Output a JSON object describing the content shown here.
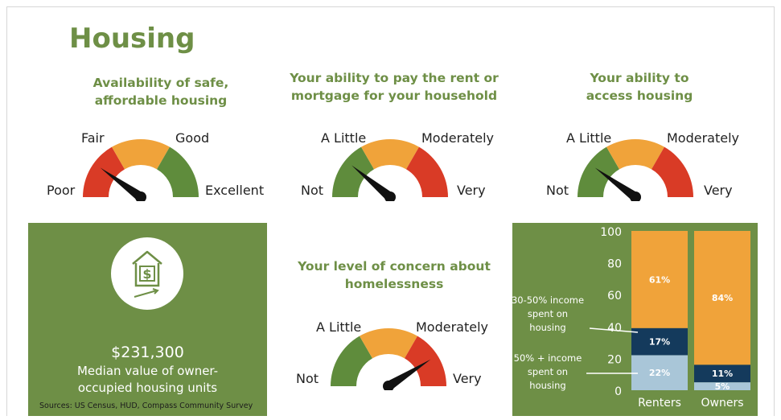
{
  "page": {
    "title": "Housing"
  },
  "gauges": [
    {
      "title_line1": "Availability of safe,",
      "title_line2": "affordable housing",
      "labels": {
        "far_left": "Poor",
        "upper_left": "Fair",
        "upper_right": "Good",
        "far_right": "Excellent"
      },
      "segment_colors": [
        "#d93b26",
        "#f0a33a",
        "#5f8c3c"
      ],
      "needle_level": 0.2
    },
    {
      "title_line1": "Your ability to pay the rent or",
      "title_line2": "mortgage for your household",
      "labels": {
        "far_left": "Not",
        "upper_left": "A Little",
        "upper_right": "Moderately",
        "far_right": "Very"
      },
      "segment_colors": [
        "#5f8c3c",
        "#f0a33a",
        "#d93b26"
      ],
      "needle_level": 0.22
    },
    {
      "title_line1": "Your ability to",
      "title_line2": "access housing",
      "labels": {
        "far_left": "Not",
        "upper_left": "A Little",
        "upper_right": "Moderately",
        "far_right": "Very"
      },
      "segment_colors": [
        "#5f8c3c",
        "#f0a33a",
        "#d93b26"
      ],
      "needle_level": 0.2
    },
    {
      "title_line1": "Your level of concern about",
      "title_line2": "homelessness",
      "labels": {
        "far_left": "Not",
        "upper_left": "A Little",
        "upper_right": "Moderately",
        "far_right": "Very"
      },
      "segment_colors": [
        "#5f8c3c",
        "#f0a33a",
        "#d93b26"
      ],
      "needle_level": 0.82
    }
  ],
  "median": {
    "value": "$231,300",
    "label_line1": "Median value of owner-",
    "label_line2": "occupied housing units",
    "sources": "Sources: US Census, HUD, Compass Community Survey"
  },
  "chart_data": {
    "type": "bar",
    "stacked": true,
    "categories": [
      "Renters",
      "Owners"
    ],
    "series": [
      {
        "name": "50% + income spent on housing",
        "values": [
          22,
          5
        ],
        "labels": [
          "22%",
          "5%"
        ],
        "color": "#a9c6d8"
      },
      {
        "name": "30-50% income spent on housing",
        "values": [
          17,
          11
        ],
        "labels": [
          "17%",
          "11%"
        ],
        "color": "#143a5c"
      },
      {
        "values": [
          61,
          84
        ],
        "labels": [
          "61%",
          "84%"
        ],
        "color": "#f0a33a"
      }
    ],
    "ylim": [
      0,
      100
    ],
    "yticks": [
      "0",
      "20",
      "40",
      "60",
      "80",
      "100"
    ],
    "annotations": {
      "a1": {
        "line1": "30-50% income",
        "line2": "spent on",
        "line3": "housing"
      },
      "a2": {
        "line1": "50% + income",
        "line2": "spent on",
        "line3": "housing"
      }
    }
  }
}
